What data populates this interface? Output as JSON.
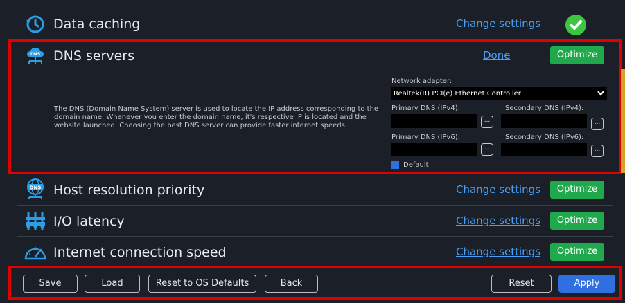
{
  "rows": {
    "data_caching": {
      "title": "Data caching",
      "link": "Change settings"
    },
    "dns_servers": {
      "title": "DNS servers",
      "link": "Done",
      "button": "Optimize"
    },
    "host_resolution": {
      "title": "Host resolution priority",
      "link": "Change settings",
      "button": "Optimize"
    },
    "io_latency": {
      "title": "I/O latency",
      "link": "Change settings",
      "button": "Optimize"
    },
    "internet_speed": {
      "title": "Internet connection speed",
      "link": "Change settings",
      "button": "Optimize"
    }
  },
  "dns_panel": {
    "description": "The DNS (Domain Name System) server is used to locate the IP address corresponding to the domain name. Whenever you enter the domain name, it's respective IP is located and the website launched. Choosing the best DNS server can provide faster internet speeds.",
    "network_adapter_label": "Network adapter:",
    "network_adapter_value": "Realtek(R) PCI(e) Ethernet Controller",
    "primary_ipv4_label": "Primary DNS (IPv4):",
    "secondary_ipv4_label": "Secondary DNS (IPv4):",
    "primary_ipv6_label": "Primary DNS (IPv6):",
    "secondary_ipv6_label": "Secondary DNS (IPv6):",
    "browse_label": "...",
    "default_label": "Default"
  },
  "footer": {
    "save": "Save",
    "load": "Load",
    "reset_os": "Reset to OS Defaults",
    "back": "Back",
    "reset": "Reset",
    "apply": "Apply"
  },
  "colors": {
    "background": "#1b1f27",
    "link": "#4a9ff5",
    "optimize": "#1fa84c",
    "apply": "#2f6fe0",
    "highlight_border": "#e00000",
    "checkmark": "#3cc63f"
  },
  "icons": {
    "data_caching": "history-clock-icon",
    "dns_servers": "dns-cloud-icon",
    "host_resolution": "dns-globe-icon",
    "io_latency": "io-sliders-icon",
    "internet_speed": "speedometer-icon",
    "status": "checkmark-icon",
    "dropdown": "chevron-down-icon"
  }
}
